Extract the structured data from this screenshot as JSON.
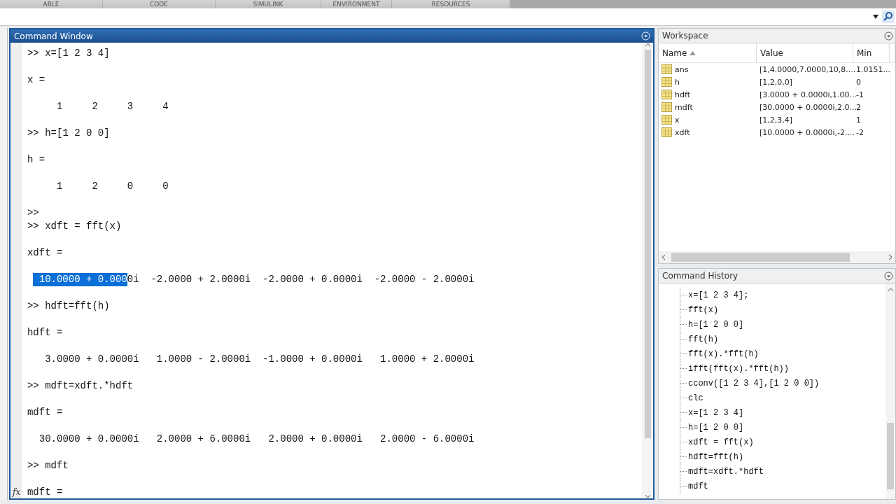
{
  "toolstrip_tabs": [
    {
      "label": "ABLE"
    },
    {
      "label": "CODE"
    },
    {
      "label": "SIMULINK"
    },
    {
      "label": "ENVIRONMENT"
    },
    {
      "label": "RESOURCES"
    }
  ],
  "command_window": {
    "title": "Command Window",
    "fx": "fx",
    "lines": [
      {
        "kind": "input",
        "prompt": ">>",
        "text": "x=[1 2 3 4]"
      },
      {
        "kind": "output",
        "segments": [
          {
            "text": "x =",
            "selected": false
          }
        ]
      },
      {
        "kind": "output",
        "segments": [
          {
            "text": "     1     2     3     4",
            "selected": false
          }
        ]
      },
      {
        "kind": "input",
        "prompt": ">>",
        "text": "h=[1 2 0 0]"
      },
      {
        "kind": "output",
        "segments": [
          {
            "text": "h =",
            "selected": false
          }
        ]
      },
      {
        "kind": "output",
        "segments": [
          {
            "text": "     1     2     0     0",
            "selected": false
          }
        ]
      },
      {
        "kind": "empty_prompt",
        "prompt": ">>"
      },
      {
        "kind": "input",
        "prompt": ">>",
        "text": "xdft = fft(x)"
      },
      {
        "kind": "output",
        "segments": [
          {
            "text": "xdft =",
            "selected": false
          }
        ]
      },
      {
        "kind": "output",
        "segments": [
          {
            "text": " 10.0000 + 0.000",
            "selected": true
          },
          {
            "text": "0i  -2.0000 + 2.0000i  -2.0000 + 0.0000i  -2.0000 - 2.0000i",
            "selected": false
          }
        ]
      },
      {
        "kind": "input",
        "prompt": ">>",
        "text": "hdft=fft(h)"
      },
      {
        "kind": "output",
        "segments": [
          {
            "text": "hdft =",
            "selected": false
          }
        ]
      },
      {
        "kind": "output",
        "segments": [
          {
            "text": "   3.0000 + 0.0000i   1.0000 - 2.0000i  -1.0000 + 0.0000i   1.0000 + 2.0000i",
            "selected": false
          }
        ]
      },
      {
        "kind": "input",
        "prompt": ">>",
        "text": "mdft=xdft.*hdft"
      },
      {
        "kind": "output",
        "segments": [
          {
            "text": "mdft =",
            "selected": false
          }
        ]
      },
      {
        "kind": "output",
        "segments": [
          {
            "text": "  30.0000 + 0.0000i   2.0000 + 6.0000i   2.0000 + 0.0000i   2.0000 - 6.0000i",
            "selected": false
          }
        ]
      },
      {
        "kind": "input",
        "prompt": ">>",
        "text": "mdft"
      },
      {
        "kind": "output",
        "segments": [
          {
            "text": "mdft =",
            "selected": false
          }
        ]
      }
    ]
  },
  "workspace": {
    "title": "Workspace",
    "columns": [
      "Name",
      "Value",
      "Min"
    ],
    "rows": [
      {
        "name": "ans",
        "value": "[1,4.0000,7.0000,10,8....",
        "min": "1.0151..."
      },
      {
        "name": "h",
        "value": "[1,2,0,0]",
        "min": "0"
      },
      {
        "name": "hdft",
        "value": "[3.0000 + 0.0000i,1.00...",
        "min": "-1"
      },
      {
        "name": "mdft",
        "value": "[30.0000 + 0.0000i,2.0...",
        "min": "2"
      },
      {
        "name": "x",
        "value": "[1,2,3,4]",
        "min": "1"
      },
      {
        "name": "xdft",
        "value": "[10.0000 + 0.0000i,-2....",
        "min": "-2"
      }
    ]
  },
  "command_history": {
    "title": "Command History",
    "items": [
      "x=[1 2 3 4];",
      "fft(x)",
      "h=[1 2 0 0]",
      "fft(h)",
      "fft(x).*fft(h)",
      "ifft(fft(x).*fft(h))",
      "cconv([1 2 3 4],[1 2 0 0])",
      "clc",
      "x=[1 2 3 4]",
      "h=[1 2 0 0]",
      "xdft = fft(x)",
      "hdft=fft(h)",
      "mdft=xdft.*hdft",
      "mdft"
    ]
  }
}
